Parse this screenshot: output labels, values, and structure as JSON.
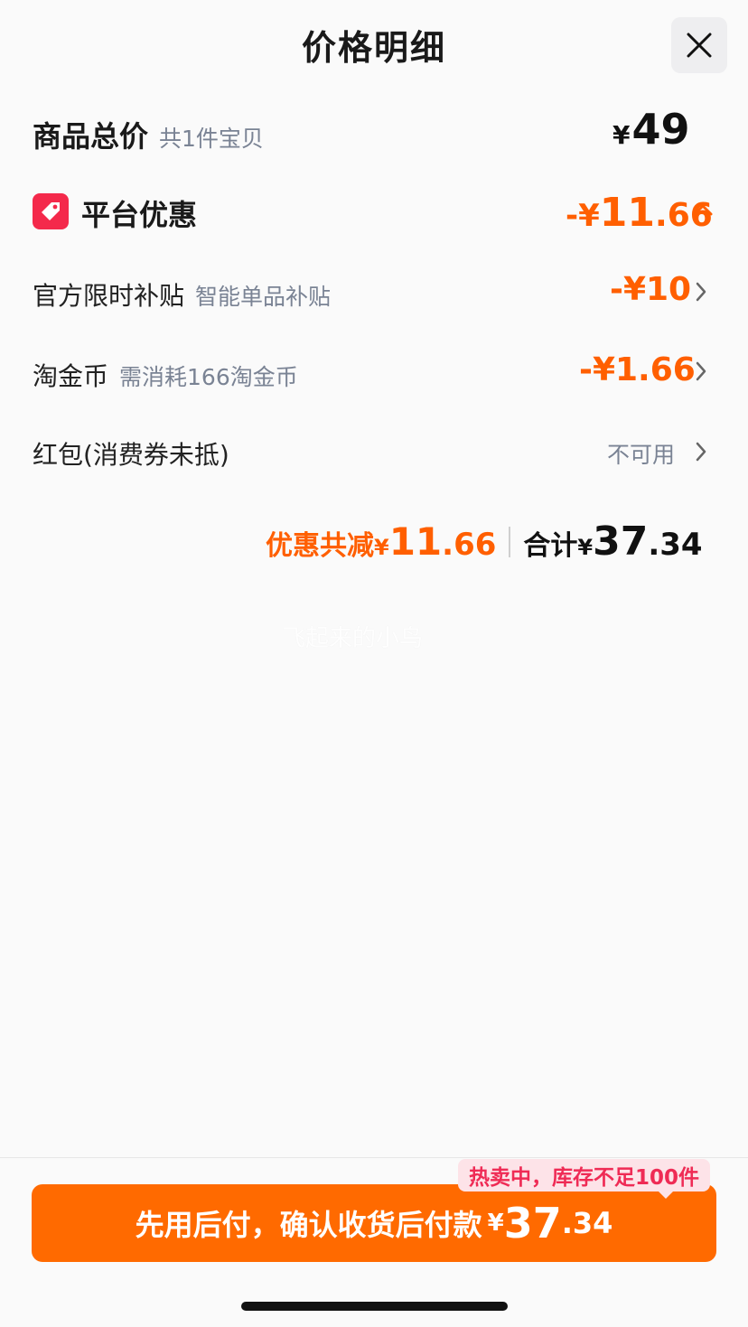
{
  "header": {
    "title": "价格明细",
    "close_icon": "close-icon"
  },
  "total_goods": {
    "label": "商品总价",
    "sub": "共1件宝贝",
    "currency": "¥",
    "amount": "49"
  },
  "platform_discount": {
    "label": "平台优惠",
    "icon": "tag-icon",
    "prefix": "-¥",
    "amount_int": "11",
    "amount_dec": ".66",
    "expand_icon": "chevron-up-icon"
  },
  "subsidy": {
    "label": "官方限时补贴",
    "sub": "智能单品补贴",
    "value": "-¥10"
  },
  "coins": {
    "label": "淘金币",
    "sub": "需消耗166淘金币",
    "value": "-¥1.66"
  },
  "red_packet": {
    "label": "红包(消费券未抵)",
    "value": "不可用"
  },
  "summary": {
    "discount_label": "优惠共减",
    "discount_currency": "¥",
    "discount_int": "11",
    "discount_dec": ".66",
    "total_label": "合计",
    "total_currency": "¥",
    "total_int": "37",
    "total_dec": ".34"
  },
  "watermark": "飞起来的小鸟",
  "stock_tag": "热卖中，库存不足100件",
  "pay_button": {
    "label": "先用后付，确认收货后付款",
    "currency": "¥",
    "amount_int": "37",
    "amount_dec": ".34"
  },
  "colors": {
    "accent": "#ff6a00",
    "discount": "#ff5f00",
    "tag_bg": "#fde3e8",
    "tag_text": "#ef2b55",
    "badge_red": "#f4294b"
  }
}
